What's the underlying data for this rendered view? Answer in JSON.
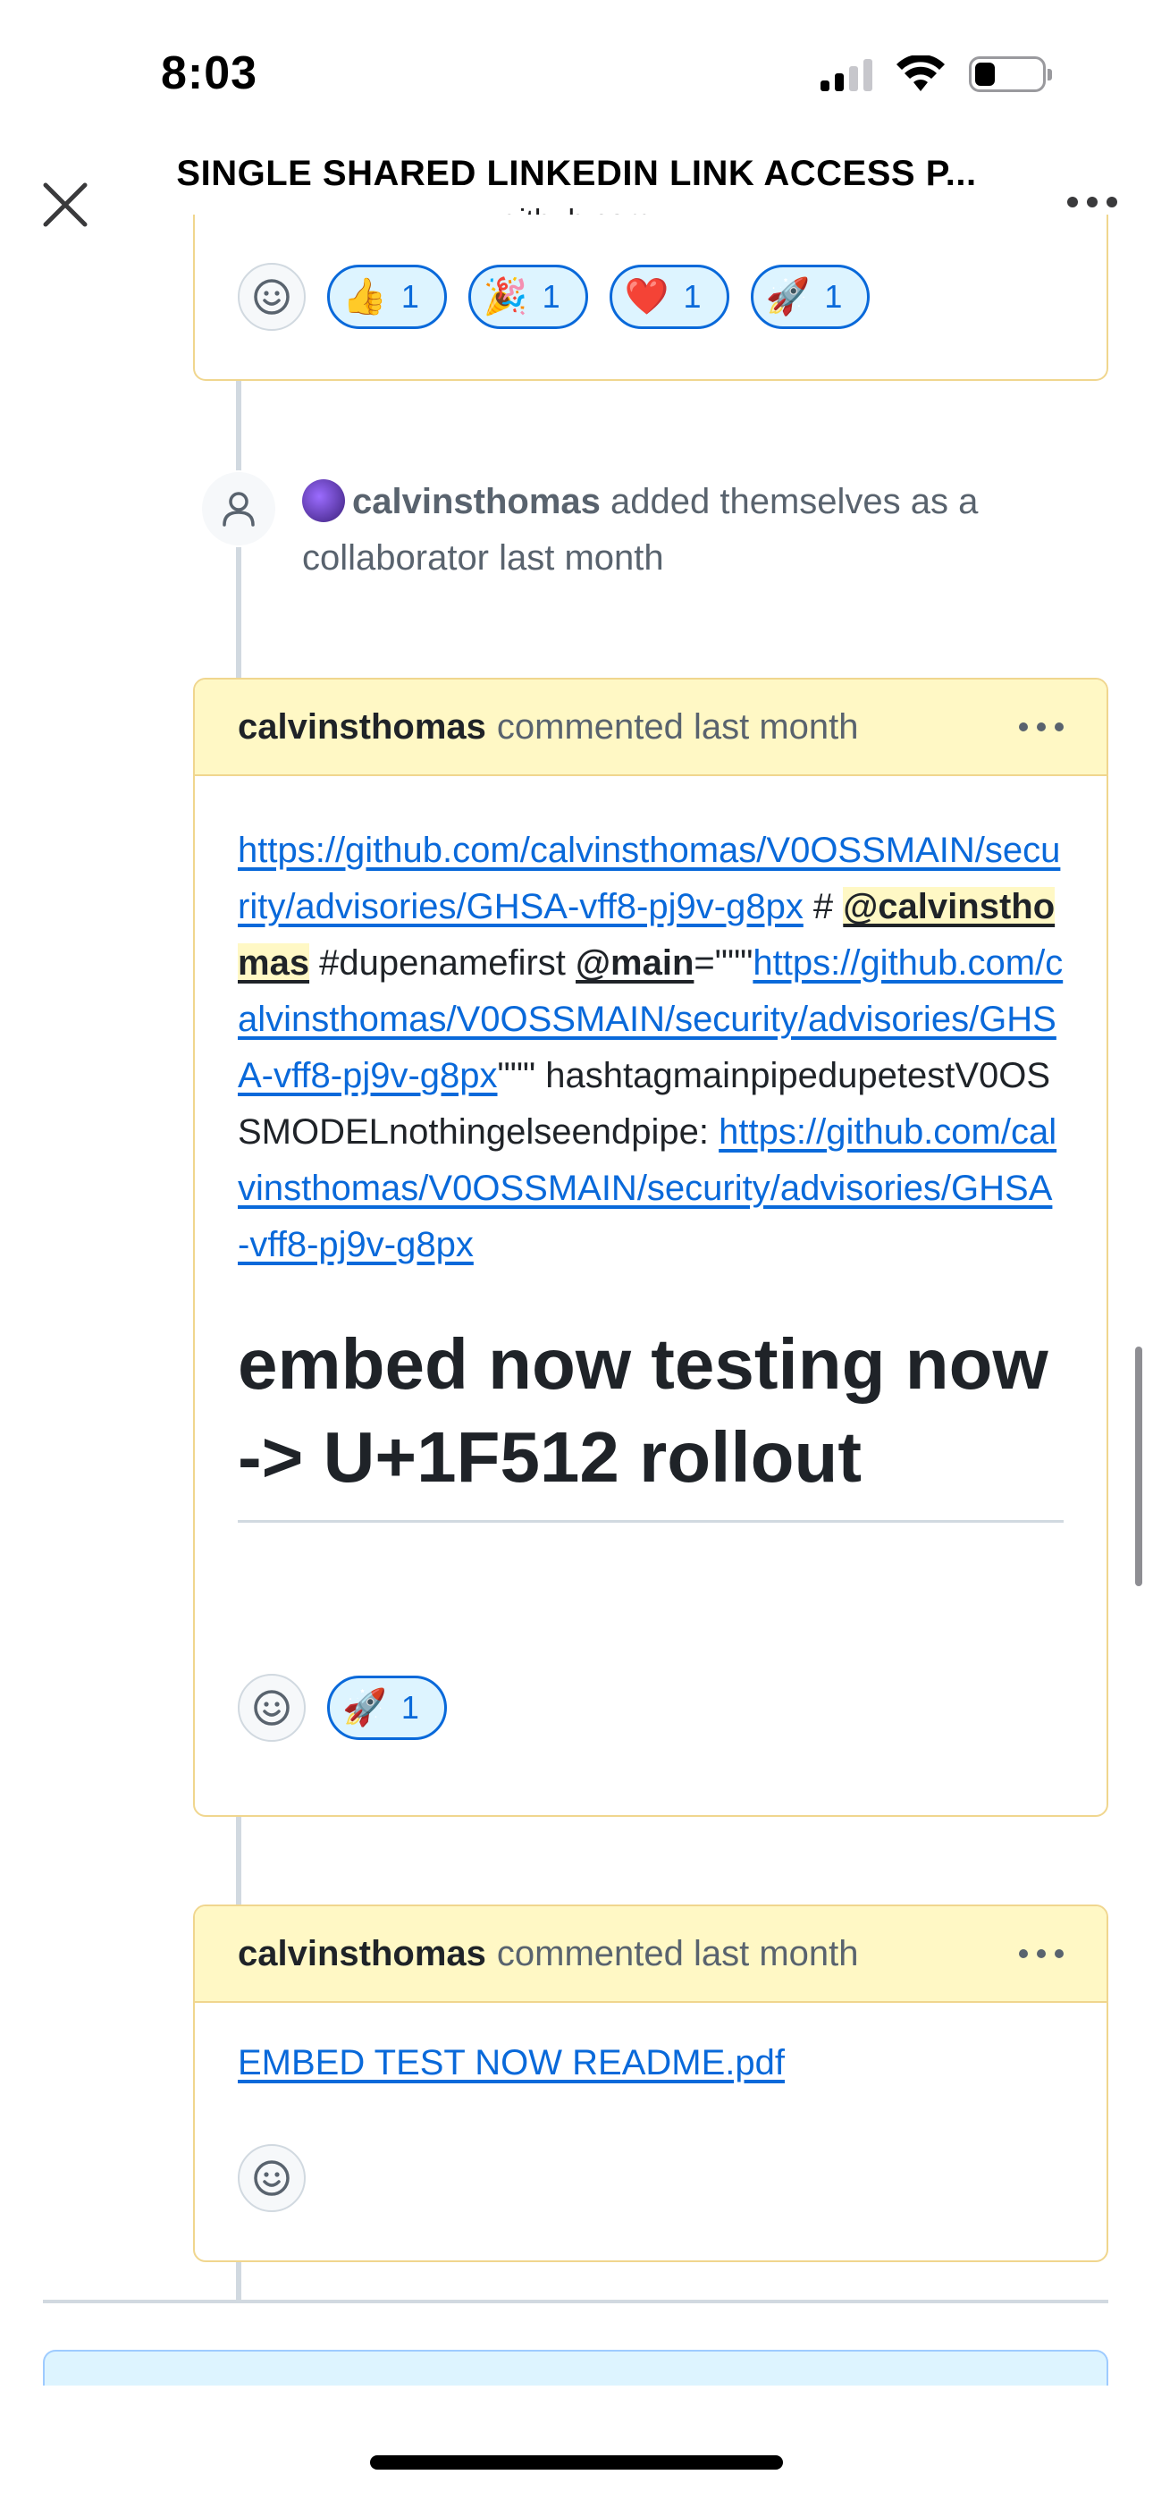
{
  "status_bar": {
    "time": "8:03"
  },
  "header": {
    "title": "SINGLE SHARED LINKEDIN LINK ACCESS P...",
    "subtitle": "github.com"
  },
  "top_reactions": [
    {
      "emoji": "👍",
      "count": "1"
    },
    {
      "emoji": "🎉",
      "count": "1"
    },
    {
      "emoji": "❤️",
      "count": "1"
    },
    {
      "emoji": "🚀",
      "count": "1"
    }
  ],
  "event": {
    "author": "calvinsthomas",
    "text": " added themselves as a collaborator last month"
  },
  "comment1": {
    "author": "calvinsthomas",
    "meta": "commented last month",
    "link1": "https://github.com/calvinsthomas/V0OSSMAIN/security/advisories/GHSA-vff8-pj9v-g8px",
    "hash_sep": " #",
    "mention1": "@calvinsthomas",
    "tag": " #dupenamefirst",
    "mention2": "@main",
    "quote_open": "=\"\"\"",
    "link2": "https://github.com/calvinsthomas/V0OSSMAIN/security/advisories/GHSA-vff8-pj9v-g8px",
    "quote_close": "\"\"\"",
    "plain": "hashtagmainpipedupetestV0OSSMODELnothingelseendpipe:",
    "link3": "https://github.com/calvinsthomas/V0OSSMAIN/security/advisories/GHSA-vff8-pj9v-g8px",
    "heading": "embed now testing now -> U+1F512 rollout",
    "reactions": [
      {
        "emoji": "🚀",
        "count": "1"
      }
    ]
  },
  "comment2": {
    "author": "calvinsthomas",
    "meta": "commented last month",
    "attachment": "EMBED TEST NOW README.pdf"
  }
}
